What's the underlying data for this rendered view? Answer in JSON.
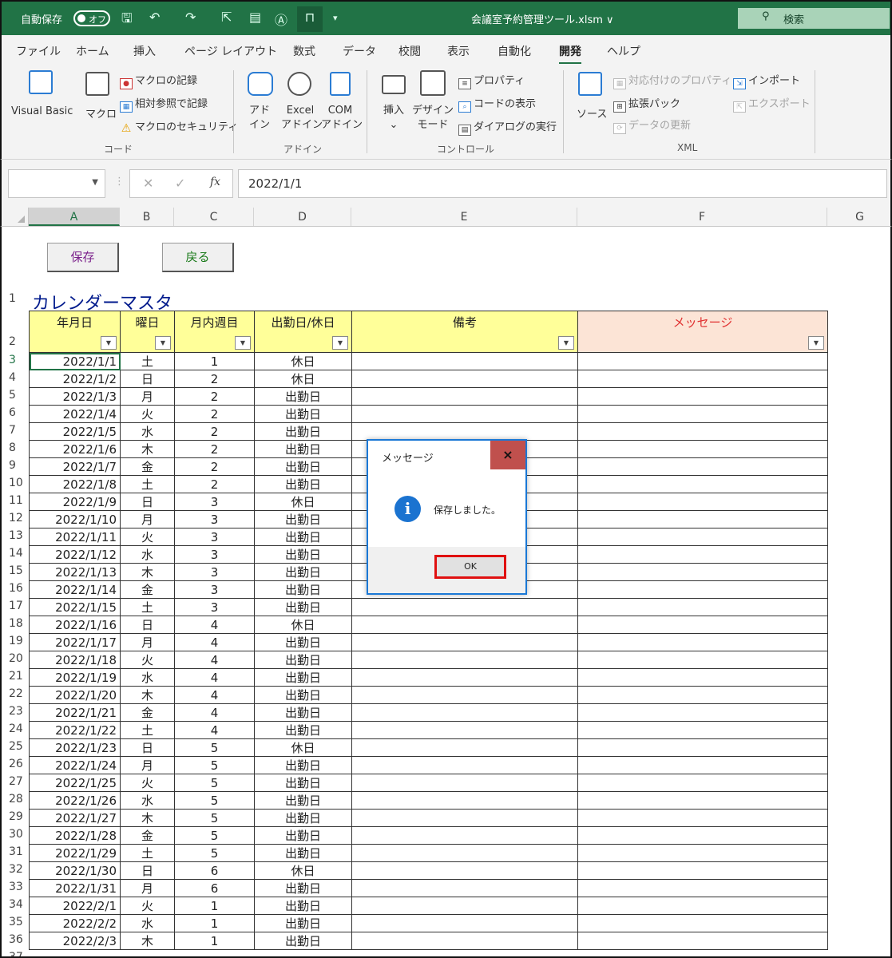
{
  "titlebar": {
    "autosave": "自動保存",
    "toggle": "オフ",
    "filename": "会議室予約管理ツール.xlsm ∨",
    "search": "検索"
  },
  "menu": [
    "ファイル",
    "ホーム",
    "挿入",
    "ページ レイアウト",
    "数式",
    "データ",
    "校閲",
    "表示",
    "自動化",
    "開発",
    "ヘルプ"
  ],
  "ribbon": {
    "code": {
      "vb": "Visual Basic",
      "macro": "マクロ",
      "rec": "マクロの記録",
      "rel": "相対参照で記録",
      "sec": "マクロのセキュリティ",
      "group": "コード"
    },
    "addin": {
      "a1": "アド",
      "a1b": "イン",
      "a2": "Excel",
      "a2b": "アドイン",
      "a3": "COM",
      "a3b": "アドイン",
      "group": "アドイン"
    },
    "ctrl": {
      "ins": "挿入",
      "design": "デザイン",
      "designb": "モード",
      "prop": "プロパティ",
      "code": "コードの表示",
      "dlg": "ダイアログの実行",
      "group": "コントロール"
    },
    "xml": {
      "src": "ソース",
      "map": "対応付けのプロパティ",
      "pack": "拡張パック",
      "refresh": "データの更新",
      "imp": "インポート",
      "exp": "エクスポート",
      "group": "XML"
    }
  },
  "formula": {
    "fx": "fx",
    "value": "2022/1/1"
  },
  "cols": [
    "A",
    "B",
    "C",
    "D",
    "E",
    "F",
    "G"
  ],
  "buttons": {
    "save": "保存",
    "back": "戻る"
  },
  "sheet_title": "カレンダーマスタ",
  "headers": [
    "年月日",
    "曜日",
    "月内週目",
    "出勤日/休日",
    "備考",
    "メッセージ"
  ],
  "rows": [
    [
      "2022/1/1",
      "土",
      "1",
      "休日"
    ],
    [
      "2022/1/2",
      "日",
      "2",
      "休日"
    ],
    [
      "2022/1/3",
      "月",
      "2",
      "出勤日"
    ],
    [
      "2022/1/4",
      "火",
      "2",
      "出勤日"
    ],
    [
      "2022/1/5",
      "水",
      "2",
      "出勤日"
    ],
    [
      "2022/1/6",
      "木",
      "2",
      "出勤日"
    ],
    [
      "2022/1/7",
      "金",
      "2",
      "出勤日"
    ],
    [
      "2022/1/8",
      "土",
      "2",
      "出勤日"
    ],
    [
      "2022/1/9",
      "日",
      "3",
      "休日"
    ],
    [
      "2022/1/10",
      "月",
      "3",
      "出勤日"
    ],
    [
      "2022/1/11",
      "火",
      "3",
      "出勤日"
    ],
    [
      "2022/1/12",
      "水",
      "3",
      "出勤日"
    ],
    [
      "2022/1/13",
      "木",
      "3",
      "出勤日"
    ],
    [
      "2022/1/14",
      "金",
      "3",
      "出勤日"
    ],
    [
      "2022/1/15",
      "土",
      "3",
      "出勤日"
    ],
    [
      "2022/1/16",
      "日",
      "4",
      "休日"
    ],
    [
      "2022/1/17",
      "月",
      "4",
      "出勤日"
    ],
    [
      "2022/1/18",
      "火",
      "4",
      "出勤日"
    ],
    [
      "2022/1/19",
      "水",
      "4",
      "出勤日"
    ],
    [
      "2022/1/20",
      "木",
      "4",
      "出勤日"
    ],
    [
      "2022/1/21",
      "金",
      "4",
      "出勤日"
    ],
    [
      "2022/1/22",
      "土",
      "4",
      "出勤日"
    ],
    [
      "2022/1/23",
      "日",
      "5",
      "休日"
    ],
    [
      "2022/1/24",
      "月",
      "5",
      "出勤日"
    ],
    [
      "2022/1/25",
      "火",
      "5",
      "出勤日"
    ],
    [
      "2022/1/26",
      "水",
      "5",
      "出勤日"
    ],
    [
      "2022/1/27",
      "木",
      "5",
      "出勤日"
    ],
    [
      "2022/1/28",
      "金",
      "5",
      "出勤日"
    ],
    [
      "2022/1/29",
      "土",
      "5",
      "出勤日"
    ],
    [
      "2022/1/30",
      "日",
      "6",
      "休日"
    ],
    [
      "2022/1/31",
      "月",
      "6",
      "出勤日"
    ],
    [
      "2022/2/1",
      "火",
      "1",
      "出勤日"
    ],
    [
      "2022/2/2",
      "水",
      "1",
      "出勤日"
    ],
    [
      "2022/2/3",
      "木",
      "1",
      "出勤日"
    ]
  ],
  "dialog": {
    "title": "メッセージ",
    "close": "×",
    "message": "保存しました。",
    "ok": "OK"
  },
  "colors": {
    "excel_green": "#217346",
    "header_yellow": "#ffff99",
    "message_header": "#fce4d6",
    "holiday_red": "#e32222",
    "title_blue": "#001a8c"
  }
}
